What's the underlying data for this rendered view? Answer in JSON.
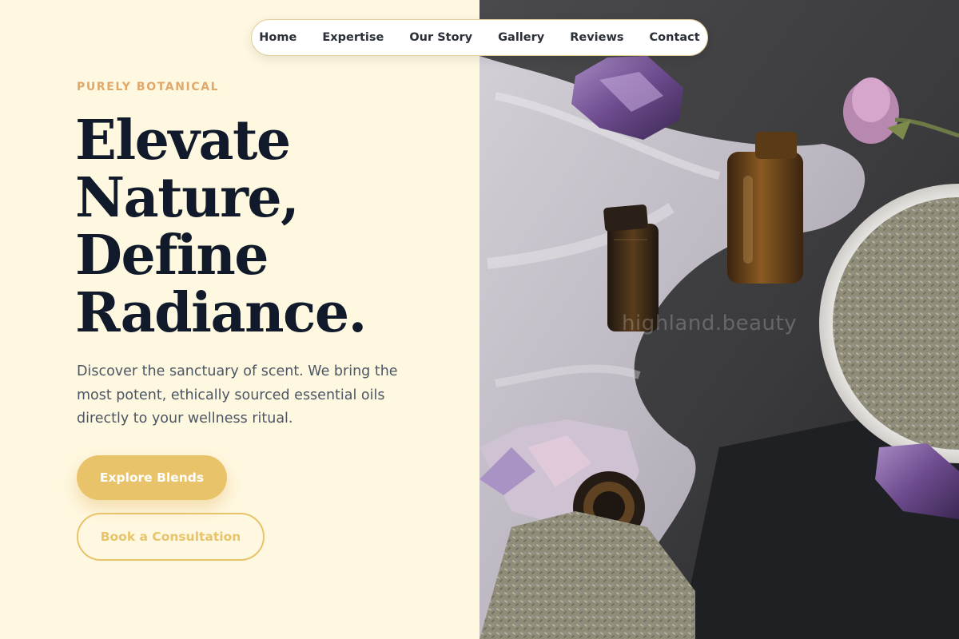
{
  "nav": {
    "items": [
      {
        "label": "Home"
      },
      {
        "label": "Expertise"
      },
      {
        "label": "Our Story"
      },
      {
        "label": "Gallery"
      },
      {
        "label": "Reviews"
      },
      {
        "label": "Contact"
      }
    ]
  },
  "hero": {
    "eyebrow": "PURELY BOTANICAL",
    "headline_lines": [
      "Elevate",
      "Nature,",
      "Define",
      "Radiance."
    ],
    "lede": "Discover the sanctuary of scent. We bring the most potent, ethically sourced essential oils directly to your wellness ritual.",
    "primary_cta": "Explore Blends",
    "secondary_cta": "Book a Consultation"
  },
  "image": {
    "watermark": "highland.beauty",
    "subjects": [
      "amber-bottle",
      "amethyst-crystal",
      "dried-lavender-bowl",
      "rosebud",
      "linen-cloth"
    ]
  },
  "colors": {
    "background": "#fff8e1",
    "accent": "#e8c36a",
    "eyebrow": "#e0a86a",
    "headline": "#111a2a",
    "body": "#4b5563"
  }
}
